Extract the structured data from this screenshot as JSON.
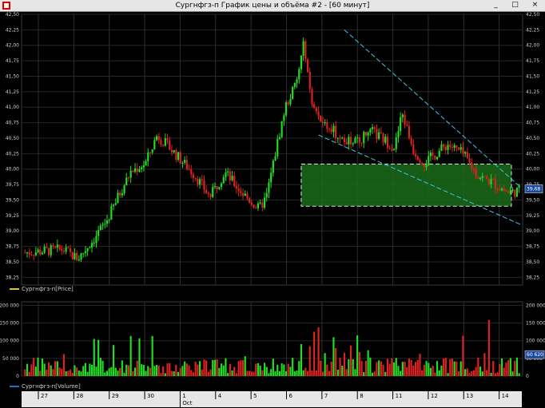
{
  "window": {
    "title": "Сургнфгз-п График цены и объёма #2 - [60 минут]"
  },
  "colors": {
    "up": "#22dd22",
    "down": "#dd2222",
    "trend": "#3ec8e6",
    "zone": "#1a6b1a",
    "badge_bg": "#1a4aa0",
    "legend_price": "#e8c800",
    "legend_volume": "#1e6fd0"
  },
  "price_axis": {
    "ticks": [
      "42,50",
      "42,25",
      "42,00",
      "41,75",
      "41,50",
      "41,25",
      "41,00",
      "40,75",
      "40,50",
      "40,25",
      "40,00",
      "39,75",
      "39,50",
      "39,25",
      "39,00",
      "38,75",
      "38,50",
      "38,25"
    ],
    "current_value": "39,68"
  },
  "volume_axis": {
    "ticks": [
      "200 000",
      "150 000",
      "100 000",
      "50 000",
      "0"
    ],
    "current_value": "60 620"
  },
  "legend": {
    "price": "Сургнфгз-п[Price]",
    "volume": "Сургнфгз-п[Volume]"
  },
  "x_axis": {
    "dates": [
      "27",
      "28",
      "29",
      "30",
      "1",
      "4",
      "5",
      "6",
      "7",
      "8",
      "11",
      "12",
      "13",
      "14"
    ],
    "month": "Oct"
  },
  "chart_data": [
    {
      "type": "candlestick",
      "ylim": [
        38.125,
        42.5
      ],
      "zone": [
        39.4,
        40.08
      ],
      "trend_upper": [
        [
          42.25,
          39.7
        ]
      ],
      "trend_lower": [
        [
          40.55,
          39.1
        ]
      ]
    },
    {
      "type": "bar",
      "ylim": [
        0,
        210000
      ]
    }
  ]
}
